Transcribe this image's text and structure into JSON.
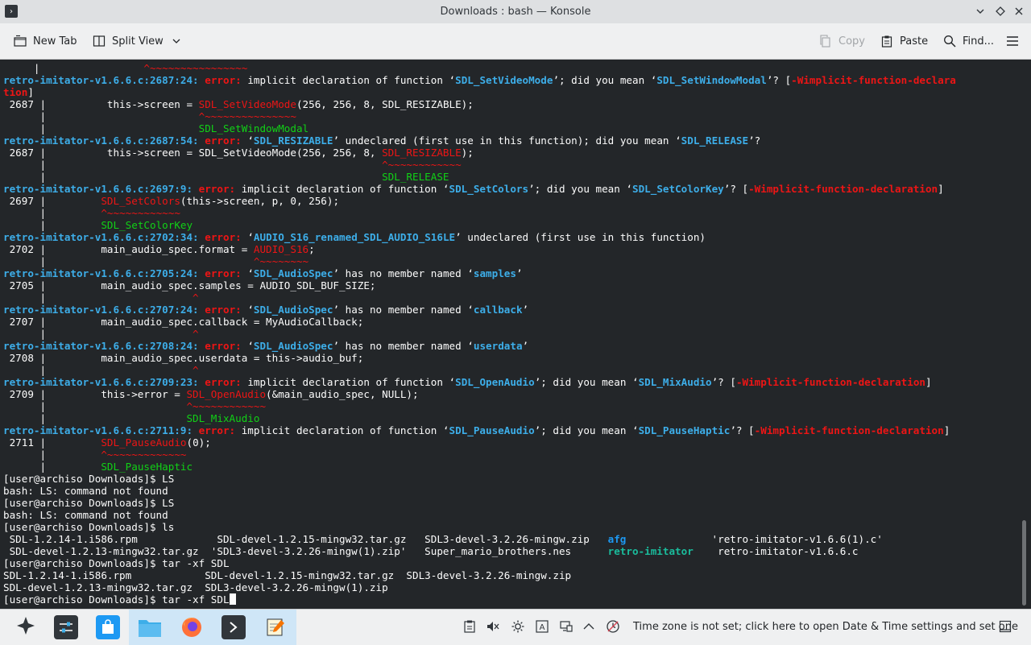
{
  "window": {
    "title": "Downloads : bash — Konsole",
    "app_icon": "konsole-icon"
  },
  "toolbar": {
    "new_tab": "New Tab",
    "split_view": "Split View",
    "copy": "Copy",
    "paste": "Paste",
    "find": "Find..."
  },
  "terminal": {
    "lines": [
      {
        "segs": [
          {
            "t": "     |"
          },
          {
            "t": "                 ^~~~~~~~~~~~~~~~~",
            "c": "red"
          }
        ]
      },
      {
        "segs": [
          {
            "t": "retro-imitator-v1.6.6.c:2687:24:",
            "c": "loc"
          },
          {
            "t": " "
          },
          {
            "t": "error:",
            "c": "err"
          },
          {
            "t": " implicit declaration of function ‘"
          },
          {
            "t": "SDL_SetVideoMode",
            "c": "blu"
          },
          {
            "t": "’; did you mean ‘"
          },
          {
            "t": "SDL_SetWindowModal",
            "c": "blu"
          },
          {
            "t": "’? ["
          },
          {
            "t": "-Wimplicit-function-declara",
            "c": "err"
          }
        ]
      },
      {
        "segs": [
          {
            "t": "tion",
            "c": "err"
          },
          {
            "t": "]"
          }
        ]
      },
      {
        "segs": [
          {
            "t": " 2687 |          this->screen = "
          },
          {
            "t": "SDL_SetVideoMode",
            "c": "red"
          },
          {
            "t": "(256, 256, 8, SDL_RESIZABLE);"
          }
        ]
      },
      {
        "segs": [
          {
            "t": "      |                         "
          },
          {
            "t": "^~~~~~~~~~~~~~~~",
            "c": "red"
          }
        ]
      },
      {
        "segs": [
          {
            "t": "      |                         "
          },
          {
            "t": "SDL_SetWindowModal",
            "c": "grn"
          }
        ]
      },
      {
        "segs": [
          {
            "t": "retro-imitator-v1.6.6.c:2687:54:",
            "c": "loc"
          },
          {
            "t": " "
          },
          {
            "t": "error:",
            "c": "err"
          },
          {
            "t": " ‘"
          },
          {
            "t": "SDL_RESIZABLE",
            "c": "blu"
          },
          {
            "t": "’ undeclared (first use in this function); did you mean ‘"
          },
          {
            "t": "SDL_RELEASE",
            "c": "blu"
          },
          {
            "t": "’?"
          }
        ]
      },
      {
        "segs": [
          {
            "t": " 2687 |          this->screen = SDL_SetVideoMode(256, 256, 8, "
          },
          {
            "t": "SDL_RESIZABLE",
            "c": "red"
          },
          {
            "t": ");"
          }
        ]
      },
      {
        "segs": [
          {
            "t": "      |                                                       "
          },
          {
            "t": "^~~~~~~~~~~~~",
            "c": "red"
          }
        ]
      },
      {
        "segs": [
          {
            "t": "      |                                                       "
          },
          {
            "t": "SDL_RELEASE",
            "c": "grn"
          }
        ]
      },
      {
        "segs": [
          {
            "t": "retro-imitator-v1.6.6.c:2697:9:",
            "c": "loc"
          },
          {
            "t": " "
          },
          {
            "t": "error:",
            "c": "err"
          },
          {
            "t": " implicit declaration of function ‘"
          },
          {
            "t": "SDL_SetColors",
            "c": "blu"
          },
          {
            "t": "’; did you mean ‘"
          },
          {
            "t": "SDL_SetColorKey",
            "c": "blu"
          },
          {
            "t": "’? ["
          },
          {
            "t": "-Wimplicit-function-declaration",
            "c": "err"
          },
          {
            "t": "]"
          }
        ]
      },
      {
        "segs": [
          {
            "t": " 2697 |         "
          },
          {
            "t": "SDL_SetColors",
            "c": "red"
          },
          {
            "t": "(this->screen, p, 0, 256);"
          }
        ]
      },
      {
        "segs": [
          {
            "t": "      |         "
          },
          {
            "t": "^~~~~~~~~~~~~",
            "c": "red"
          }
        ]
      },
      {
        "segs": [
          {
            "t": "      |         "
          },
          {
            "t": "SDL_SetColorKey",
            "c": "grn"
          }
        ]
      },
      {
        "segs": [
          {
            "t": "retro-imitator-v1.6.6.c:2702:34:",
            "c": "loc"
          },
          {
            "t": " "
          },
          {
            "t": "error:",
            "c": "err"
          },
          {
            "t": " ‘"
          },
          {
            "t": "AUDIO_S16_renamed_SDL_AUDIO_S16LE",
            "c": "blu"
          },
          {
            "t": "’ undeclared (first use in this function)"
          }
        ]
      },
      {
        "segs": [
          {
            "t": " 2702 |         main_audio_spec.format = "
          },
          {
            "t": "AUDIO_S16",
            "c": "red"
          },
          {
            "t": ";"
          }
        ]
      },
      {
        "segs": [
          {
            "t": "      |                                  "
          },
          {
            "t": "^~~~~~~~~",
            "c": "red"
          }
        ]
      },
      {
        "segs": [
          {
            "t": "retro-imitator-v1.6.6.c:2705:24:",
            "c": "loc"
          },
          {
            "t": " "
          },
          {
            "t": "error:",
            "c": "err"
          },
          {
            "t": " ‘"
          },
          {
            "t": "SDL_AudioSpec",
            "c": "blu"
          },
          {
            "t": "’ has no member named ‘"
          },
          {
            "t": "samples",
            "c": "blu"
          },
          {
            "t": "’"
          }
        ]
      },
      {
        "segs": [
          {
            "t": " 2705 |         main_audio_spec.samples = AUDIO_SDL_BUF_SIZE;"
          }
        ]
      },
      {
        "segs": [
          {
            "t": "      |                        "
          },
          {
            "t": "^",
            "c": "red"
          }
        ]
      },
      {
        "segs": [
          {
            "t": "retro-imitator-v1.6.6.c:2707:24:",
            "c": "loc"
          },
          {
            "t": " "
          },
          {
            "t": "error:",
            "c": "err"
          },
          {
            "t": " ‘"
          },
          {
            "t": "SDL_AudioSpec",
            "c": "blu"
          },
          {
            "t": "’ has no member named ‘"
          },
          {
            "t": "callback",
            "c": "blu"
          },
          {
            "t": "’"
          }
        ]
      },
      {
        "segs": [
          {
            "t": " 2707 |         main_audio_spec.callback = MyAudioCallback;"
          }
        ]
      },
      {
        "segs": [
          {
            "t": "      |                        "
          },
          {
            "t": "^",
            "c": "red"
          }
        ]
      },
      {
        "segs": [
          {
            "t": "retro-imitator-v1.6.6.c:2708:24:",
            "c": "loc"
          },
          {
            "t": " "
          },
          {
            "t": "error:",
            "c": "err"
          },
          {
            "t": " ‘"
          },
          {
            "t": "SDL_AudioSpec",
            "c": "blu"
          },
          {
            "t": "’ has no member named ‘"
          },
          {
            "t": "userdata",
            "c": "blu"
          },
          {
            "t": "’"
          }
        ]
      },
      {
        "segs": [
          {
            "t": " 2708 |         main_audio_spec.userdata = this->audio_buf;"
          }
        ]
      },
      {
        "segs": [
          {
            "t": "      |                        "
          },
          {
            "t": "^",
            "c": "red"
          }
        ]
      },
      {
        "segs": [
          {
            "t": "retro-imitator-v1.6.6.c:2709:23:",
            "c": "loc"
          },
          {
            "t": " "
          },
          {
            "t": "error:",
            "c": "err"
          },
          {
            "t": " implicit declaration of function ‘"
          },
          {
            "t": "SDL_OpenAudio",
            "c": "blu"
          },
          {
            "t": "’; did you mean ‘"
          },
          {
            "t": "SDL_MixAudio",
            "c": "blu"
          },
          {
            "t": "’? ["
          },
          {
            "t": "-Wimplicit-function-declaration",
            "c": "err"
          },
          {
            "t": "]"
          }
        ]
      },
      {
        "segs": [
          {
            "t": " 2709 |         this->error = "
          },
          {
            "t": "SDL_OpenAudio",
            "c": "red"
          },
          {
            "t": "(&main_audio_spec, NULL);"
          }
        ]
      },
      {
        "segs": [
          {
            "t": "      |                       "
          },
          {
            "t": "^~~~~~~~~~~~~",
            "c": "red"
          }
        ]
      },
      {
        "segs": [
          {
            "t": "      |                       "
          },
          {
            "t": "SDL_MixAudio",
            "c": "grn"
          }
        ]
      },
      {
        "segs": [
          {
            "t": "retro-imitator-v1.6.6.c:2711:9:",
            "c": "loc"
          },
          {
            "t": " "
          },
          {
            "t": "error:",
            "c": "err"
          },
          {
            "t": " implicit declaration of function ‘"
          },
          {
            "t": "SDL_PauseAudio",
            "c": "blu"
          },
          {
            "t": "’; did you mean ‘"
          },
          {
            "t": "SDL_PauseHaptic",
            "c": "blu"
          },
          {
            "t": "’? ["
          },
          {
            "t": "-Wimplicit-function-declaration",
            "c": "err"
          },
          {
            "t": "]"
          }
        ]
      },
      {
        "segs": [
          {
            "t": " 2711 |         "
          },
          {
            "t": "SDL_PauseAudio",
            "c": "red"
          },
          {
            "t": "(0);"
          }
        ]
      },
      {
        "segs": [
          {
            "t": "      |         "
          },
          {
            "t": "^~~~~~~~~~~~~~",
            "c": "red"
          }
        ]
      },
      {
        "segs": [
          {
            "t": "      |         "
          },
          {
            "t": "SDL_PauseHaptic",
            "c": "grn"
          }
        ]
      },
      {
        "segs": [
          {
            "t": "[user@archiso Downloads]$ LS"
          }
        ]
      },
      {
        "segs": [
          {
            "t": "bash: LS: command not found"
          }
        ]
      },
      {
        "segs": [
          {
            "t": "[user@archiso Downloads]$ LS"
          }
        ]
      },
      {
        "segs": [
          {
            "t": "bash: LS: command not found"
          }
        ]
      },
      {
        "segs": [
          {
            "t": "[user@archiso Downloads]$ ls"
          }
        ]
      },
      {
        "segs": [
          {
            "t": " SDL-1.2.14-1.i586.rpm             SDL-devel-1.2.15-mingw32.tar.gz   SDL3-devel-3.2.26-mingw.zip   "
          },
          {
            "t": "afg",
            "c": "dir"
          },
          {
            "t": "              'retro-imitator-v1.6.6(1).c'"
          }
        ]
      },
      {
        "segs": [
          {
            "t": " SDL-devel-1.2.13-mingw32.tar.gz  'SDL3-devel-3.2.26-mingw(1).zip'   Super_mario_brothers.nes      "
          },
          {
            "t": "retro-imitator",
            "c": "cyn"
          },
          {
            "t": "    retro-imitator-v1.6.6.c"
          }
        ]
      },
      {
        "segs": [
          {
            "t": "[user@archiso Downloads]$ tar -xf SDL"
          }
        ]
      },
      {
        "segs": [
          {
            "t": "SDL-1.2.14-1.i586.rpm            SDL-devel-1.2.15-mingw32.tar.gz  SDL3-devel-3.2.26-mingw.zip"
          }
        ]
      },
      {
        "segs": [
          {
            "t": "SDL-devel-1.2.13-mingw32.tar.gz  SDL3-devel-3.2.26-mingw(1).zip"
          }
        ]
      },
      {
        "segs": [
          {
            "t": "[user@archiso Downloads]$ tar -xf SDL"
          }
        ],
        "cursor": true
      }
    ]
  },
  "taskbar": {
    "apps": [
      {
        "name": "application-launcher",
        "icon": "launcher-icon"
      },
      {
        "name": "system-settings",
        "icon": "settings-sliders-icon"
      },
      {
        "name": "discover",
        "icon": "store-bag-icon"
      },
      {
        "name": "dolphin",
        "icon": "folder-icon"
      },
      {
        "name": "firefox",
        "icon": "firefox-icon"
      },
      {
        "name": "konsole",
        "icon": "terminal-icon"
      },
      {
        "name": "kate",
        "icon": "text-editor-icon"
      }
    ],
    "tray_message": "Time zone is not set; click here to open Date & Time settings and set one"
  },
  "colors": {
    "terminal_bg": "#232629",
    "terminal_fg": "#fcfcfc",
    "error_red": "#ed1515",
    "highlight_blue": "#3daee9",
    "hint_green": "#11d116",
    "active_task": "#cfe6f7"
  }
}
